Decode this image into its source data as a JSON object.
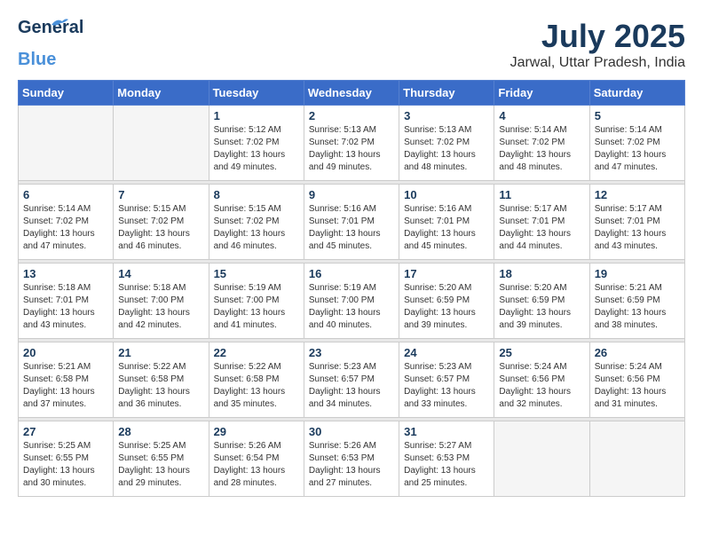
{
  "header": {
    "logo_general": "General",
    "logo_blue": "Blue",
    "month": "July 2025",
    "location": "Jarwal, Uttar Pradesh, India"
  },
  "days_of_week": [
    "Sunday",
    "Monday",
    "Tuesday",
    "Wednesday",
    "Thursday",
    "Friday",
    "Saturday"
  ],
  "weeks": [
    [
      {
        "day": "",
        "info": ""
      },
      {
        "day": "",
        "info": ""
      },
      {
        "day": "1",
        "info": "Sunrise: 5:12 AM\nSunset: 7:02 PM\nDaylight: 13 hours and 49 minutes."
      },
      {
        "day": "2",
        "info": "Sunrise: 5:13 AM\nSunset: 7:02 PM\nDaylight: 13 hours and 49 minutes."
      },
      {
        "day": "3",
        "info": "Sunrise: 5:13 AM\nSunset: 7:02 PM\nDaylight: 13 hours and 48 minutes."
      },
      {
        "day": "4",
        "info": "Sunrise: 5:14 AM\nSunset: 7:02 PM\nDaylight: 13 hours and 48 minutes."
      },
      {
        "day": "5",
        "info": "Sunrise: 5:14 AM\nSunset: 7:02 PM\nDaylight: 13 hours and 47 minutes."
      }
    ],
    [
      {
        "day": "6",
        "info": "Sunrise: 5:14 AM\nSunset: 7:02 PM\nDaylight: 13 hours and 47 minutes."
      },
      {
        "day": "7",
        "info": "Sunrise: 5:15 AM\nSunset: 7:02 PM\nDaylight: 13 hours and 46 minutes."
      },
      {
        "day": "8",
        "info": "Sunrise: 5:15 AM\nSunset: 7:02 PM\nDaylight: 13 hours and 46 minutes."
      },
      {
        "day": "9",
        "info": "Sunrise: 5:16 AM\nSunset: 7:01 PM\nDaylight: 13 hours and 45 minutes."
      },
      {
        "day": "10",
        "info": "Sunrise: 5:16 AM\nSunset: 7:01 PM\nDaylight: 13 hours and 45 minutes."
      },
      {
        "day": "11",
        "info": "Sunrise: 5:17 AM\nSunset: 7:01 PM\nDaylight: 13 hours and 44 minutes."
      },
      {
        "day": "12",
        "info": "Sunrise: 5:17 AM\nSunset: 7:01 PM\nDaylight: 13 hours and 43 minutes."
      }
    ],
    [
      {
        "day": "13",
        "info": "Sunrise: 5:18 AM\nSunset: 7:01 PM\nDaylight: 13 hours and 43 minutes."
      },
      {
        "day": "14",
        "info": "Sunrise: 5:18 AM\nSunset: 7:00 PM\nDaylight: 13 hours and 42 minutes."
      },
      {
        "day": "15",
        "info": "Sunrise: 5:19 AM\nSunset: 7:00 PM\nDaylight: 13 hours and 41 minutes."
      },
      {
        "day": "16",
        "info": "Sunrise: 5:19 AM\nSunset: 7:00 PM\nDaylight: 13 hours and 40 minutes."
      },
      {
        "day": "17",
        "info": "Sunrise: 5:20 AM\nSunset: 6:59 PM\nDaylight: 13 hours and 39 minutes."
      },
      {
        "day": "18",
        "info": "Sunrise: 5:20 AM\nSunset: 6:59 PM\nDaylight: 13 hours and 39 minutes."
      },
      {
        "day": "19",
        "info": "Sunrise: 5:21 AM\nSunset: 6:59 PM\nDaylight: 13 hours and 38 minutes."
      }
    ],
    [
      {
        "day": "20",
        "info": "Sunrise: 5:21 AM\nSunset: 6:58 PM\nDaylight: 13 hours and 37 minutes."
      },
      {
        "day": "21",
        "info": "Sunrise: 5:22 AM\nSunset: 6:58 PM\nDaylight: 13 hours and 36 minutes."
      },
      {
        "day": "22",
        "info": "Sunrise: 5:22 AM\nSunset: 6:58 PM\nDaylight: 13 hours and 35 minutes."
      },
      {
        "day": "23",
        "info": "Sunrise: 5:23 AM\nSunset: 6:57 PM\nDaylight: 13 hours and 34 minutes."
      },
      {
        "day": "24",
        "info": "Sunrise: 5:23 AM\nSunset: 6:57 PM\nDaylight: 13 hours and 33 minutes."
      },
      {
        "day": "25",
        "info": "Sunrise: 5:24 AM\nSunset: 6:56 PM\nDaylight: 13 hours and 32 minutes."
      },
      {
        "day": "26",
        "info": "Sunrise: 5:24 AM\nSunset: 6:56 PM\nDaylight: 13 hours and 31 minutes."
      }
    ],
    [
      {
        "day": "27",
        "info": "Sunrise: 5:25 AM\nSunset: 6:55 PM\nDaylight: 13 hours and 30 minutes."
      },
      {
        "day": "28",
        "info": "Sunrise: 5:25 AM\nSunset: 6:55 PM\nDaylight: 13 hours and 29 minutes."
      },
      {
        "day": "29",
        "info": "Sunrise: 5:26 AM\nSunset: 6:54 PM\nDaylight: 13 hours and 28 minutes."
      },
      {
        "day": "30",
        "info": "Sunrise: 5:26 AM\nSunset: 6:53 PM\nDaylight: 13 hours and 27 minutes."
      },
      {
        "day": "31",
        "info": "Sunrise: 5:27 AM\nSunset: 6:53 PM\nDaylight: 13 hours and 25 minutes."
      },
      {
        "day": "",
        "info": ""
      },
      {
        "day": "",
        "info": ""
      }
    ]
  ]
}
